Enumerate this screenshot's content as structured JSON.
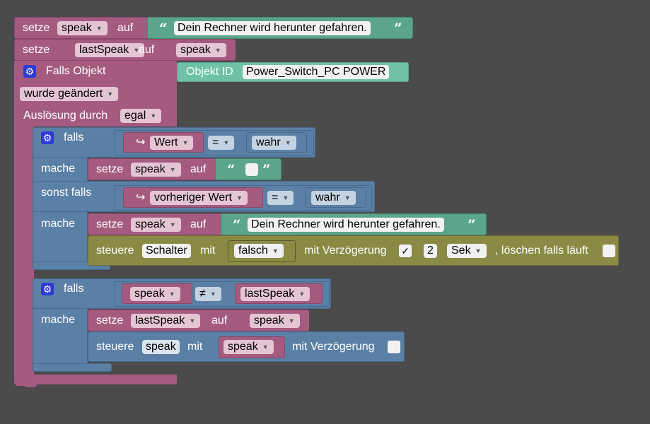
{
  "colors": {
    "background": "#4b4b4b",
    "variables": "#a55b80",
    "logic": "#5b80a5",
    "text": "#5ba58c",
    "control": "#8a8a45",
    "trigger_id": "#6fc2a8"
  },
  "block1": {
    "setze": "setze",
    "var": "speak",
    "auf": "auf",
    "text": "Dein Rechner wird herunter gefahren."
  },
  "block2": {
    "setze": "setze",
    "var": "lastSpeak",
    "auf": "auf",
    "value_var": "speak"
  },
  "trigger": {
    "title": "Falls Objekt",
    "objekt_id_label": "Objekt ID",
    "objekt_id_value": "Power_Switch_PC POWER",
    "condition": "wurde geändert",
    "ausloesung_label": "Auslösung durch",
    "ausloesung_value": "egal"
  },
  "if1": {
    "falls": "falls",
    "arrow": "↪",
    "field": "Wert",
    "op": "=",
    "bool": "wahr",
    "mache": "mache",
    "set_setze": "setze",
    "set_var": "speak",
    "set_auf": "auf",
    "sonst_falls": "sonst falls",
    "field2": "vorheriger Wert",
    "op2": "=",
    "bool2": "wahr",
    "mache2": "mache",
    "set2_setze": "setze",
    "set2_var": "speak",
    "set2_auf": "auf",
    "set2_text": "Dein Rechner wird herunter gefahren.",
    "ctrl_steuere": "steuere",
    "ctrl_obj": "Schalter",
    "ctrl_mit": "mit",
    "ctrl_value": "falsch",
    "ctrl_delay_label": "mit Verzögerung",
    "ctrl_delay_checked": "✓",
    "ctrl_delay_num": "2",
    "ctrl_unit": "Sek",
    "ctrl_clear_label": ", löschen falls läuft"
  },
  "if2": {
    "falls": "falls",
    "left": "speak",
    "op": "≠",
    "right": "lastSpeak",
    "mache": "mache",
    "set_setze": "setze",
    "set_var": "lastSpeak",
    "set_auf": "auf",
    "set_value": "speak",
    "ctrl_steuere": "steuere",
    "ctrl_obj": "speak",
    "ctrl_mit": "mit",
    "ctrl_value": "speak",
    "ctrl_delay_label": "mit Verzögerung"
  },
  "icons": {
    "gear": "⚙",
    "caret": "▼",
    "quote_open": "“",
    "quote_close": "”"
  }
}
